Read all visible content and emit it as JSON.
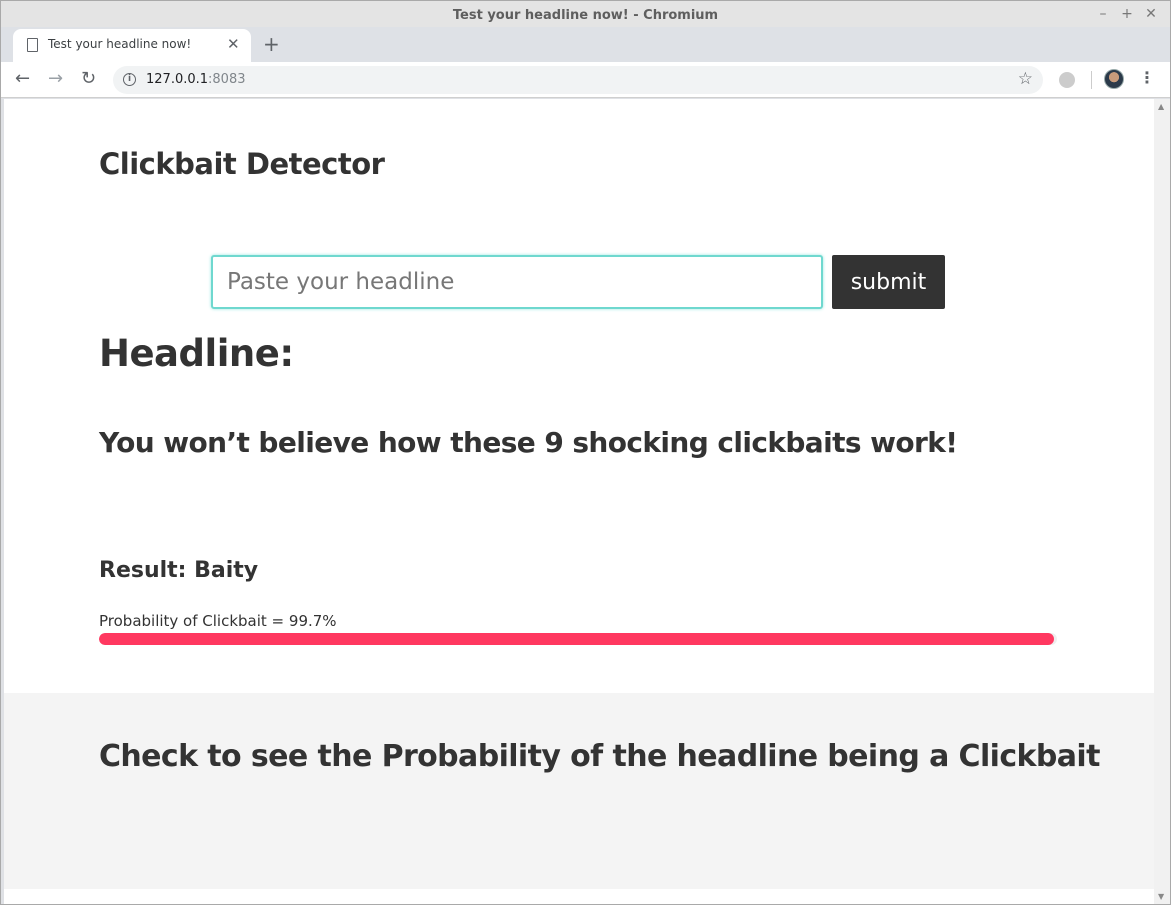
{
  "window": {
    "title": "Test your headline now! - Chromium"
  },
  "tab": {
    "label": "Test your headline now!"
  },
  "address": {
    "host": "127.0.0.1",
    "port": ":8083"
  },
  "page": {
    "title": "Clickbait Detector",
    "input_placeholder": "Paste your headline",
    "submit_label": "submit",
    "headline_heading": "Headline:",
    "headline_text": "You won’t believe how these 9 shocking clickbaits work!",
    "result_text": "Result: Baity",
    "probability_text": "Probability of Clickbait = 99.7%",
    "probability_value": 0.997,
    "bar_color": "#ff3860",
    "footer_text": "Check to see the Probability of the headline being a Clickbait"
  },
  "icons": {
    "tab": "document-icon",
    "close": "close-icon",
    "new_tab": "plus-icon",
    "back": "back-arrow-icon",
    "forward": "forward-arrow-icon",
    "reload": "reload-icon",
    "info": "info-icon",
    "bookmark": "star-icon",
    "menu": "kebab-menu-icon"
  }
}
